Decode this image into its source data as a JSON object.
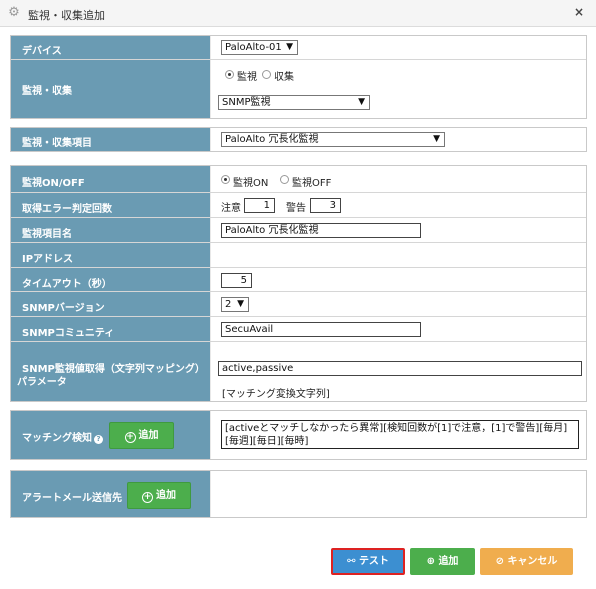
{
  "window": {
    "title": "監視・収集追加",
    "close": "×"
  },
  "device": {
    "label": "デバイス",
    "value": "PaloAlto-01"
  },
  "monitor_collect": {
    "label": "監視・収集",
    "options": [
      "監視",
      "収集"
    ],
    "type_value": "SNMP監視"
  },
  "item": {
    "label": "監視・収集項目",
    "value": "PaloAlto 冗長化監視"
  },
  "onoff": {
    "label": "監視ON/OFF",
    "options": [
      "監視ON",
      "監視OFF"
    ]
  },
  "error_count": {
    "label": "取得エラー判定回数",
    "caution_label": "注意",
    "caution_value": "1",
    "warning_label": "警告",
    "warning_value": "3"
  },
  "item_name": {
    "label": "監視項目名",
    "value": "PaloAlto 冗長化監視"
  },
  "ip": {
    "label": "IPアドレス"
  },
  "timeout": {
    "label": "タイムアウト（秒）",
    "value": "5"
  },
  "snmp_version": {
    "label": "SNMPバージョン",
    "value": "2"
  },
  "community": {
    "label": "SNMPコミュニティ",
    "value": "SecuAvail"
  },
  "param": {
    "label_line1": "SNMP監視値取得（文字列マッピング）",
    "label_line2": "パラメータ",
    "value": "active,passive",
    "hint": "[マッチング変換文字列]"
  },
  "matching": {
    "label": "マッチング検知",
    "add_label": "追加",
    "text": "[activeとマッチしなかったら異常][検知回数が[1]で注意，[1]で警告][毎月][毎週][毎日][毎時]"
  },
  "alert": {
    "label": "アラートメール送信先",
    "add_label": "追加"
  },
  "footer": {
    "test": "テスト",
    "add": "追加",
    "cancel": "キャンセル"
  }
}
